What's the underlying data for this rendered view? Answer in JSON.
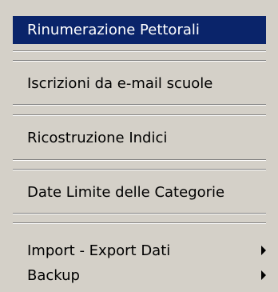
{
  "menu": {
    "items": [
      {
        "label": "Rinumerazione Pettorali",
        "highlighted": true
      },
      {
        "label": "Iscrizioni da e-mail scuole"
      },
      {
        "label": "Ricostruzione Indici"
      },
      {
        "label": "Date Limite delle Categorie"
      },
      {
        "label": "Import - Export Dati",
        "submenu": true
      },
      {
        "label": "Backup",
        "submenu": true
      }
    ]
  },
  "colors": {
    "menu_background": "#d4d0c8",
    "highlight_background": "#0a246a",
    "highlight_text": "#ffffff",
    "text": "#000000"
  }
}
